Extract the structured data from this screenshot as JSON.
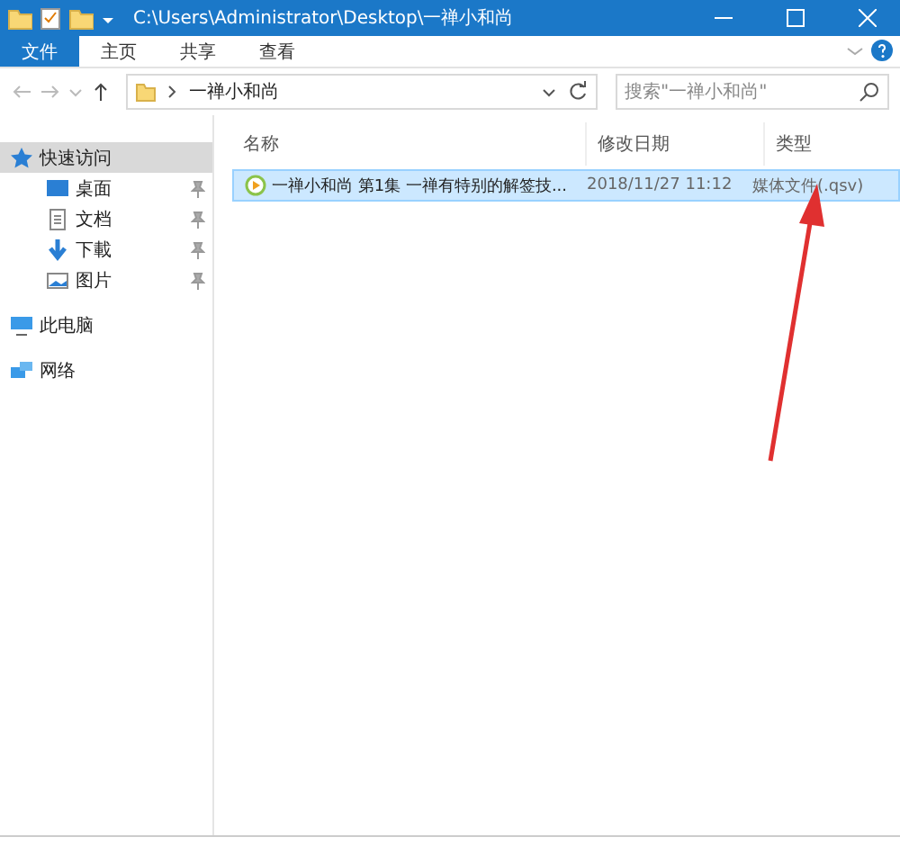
{
  "window": {
    "title": "C:\\Users\\Administrator\\Desktop\\一禅小和尚"
  },
  "ribbon_tabs": [
    {
      "label": "文件",
      "selected": true
    },
    {
      "label": "主页",
      "selected": false
    },
    {
      "label": "共享",
      "selected": false
    },
    {
      "label": "查看",
      "selected": false
    }
  ],
  "address_bar": {
    "path": "一禅小和尚"
  },
  "search": {
    "placeholder": "搜索\"一禅小和尚\""
  },
  "nav": [
    {
      "label": "快速访问",
      "kind": "quick",
      "selected": true,
      "children": [
        {
          "label": "桌面",
          "kind": "desktop",
          "selected": false,
          "pinned": true
        },
        {
          "label": "文档",
          "kind": "documents",
          "selected": false,
          "pinned": true
        },
        {
          "label": "下載",
          "kind": "downloads",
          "selected": false,
          "pinned": true
        },
        {
          "label": "图片",
          "kind": "pictures",
          "selected": false,
          "pinned": true
        }
      ]
    },
    {
      "label": "此电脑",
      "kind": "pc",
      "selected": false
    },
    {
      "label": "网络",
      "kind": "network",
      "selected": false
    }
  ],
  "columns": [
    "名称",
    "修改日期",
    "类型"
  ],
  "files": [
    {
      "name": "一禅小和尚 第1集 一禅有特别的解签技...",
      "date": "2018/11/27 11:12",
      "type": "媒体文件(.qsv)",
      "selected": true
    }
  ]
}
